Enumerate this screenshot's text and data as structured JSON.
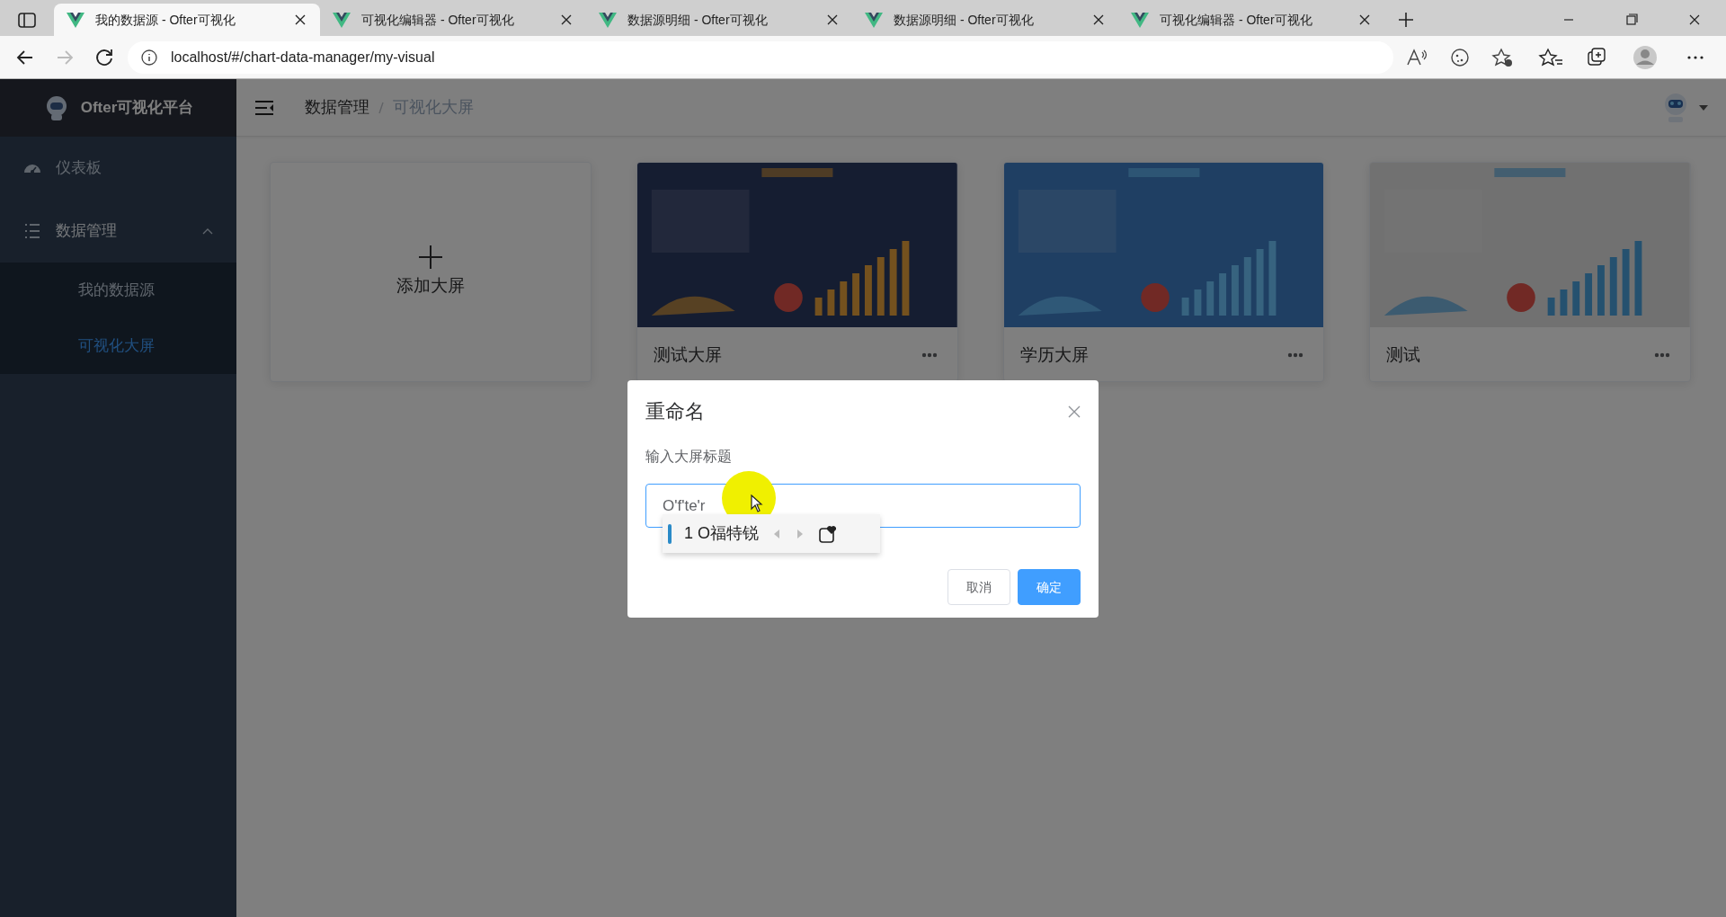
{
  "browser": {
    "tabs": [
      {
        "title": "我的数据源 - Ofter可视化",
        "selected": true
      },
      {
        "title": "可视化编辑器 - Ofter可视化",
        "selected": false
      },
      {
        "title": "数据源明细 - Ofter可视化",
        "selected": false
      },
      {
        "title": "数据源明细 - Ofter可视化",
        "selected": false
      },
      {
        "title": "可视化编辑器 - Ofter可视化",
        "selected": false
      }
    ],
    "address": "localhost/#/chart-data-manager/my-visual"
  },
  "app": {
    "brand": "Ofter可视化平台",
    "menu": [
      {
        "label": "仪表板",
        "kind": "gauge"
      },
      {
        "label": "数据管理",
        "kind": "list",
        "expanded": true,
        "children": [
          {
            "label": "我的数据源",
            "selected": false
          },
          {
            "label": "可视化大屏",
            "selected": true
          }
        ]
      }
    ],
    "breadcrumb": [
      "数据管理",
      "可视化大屏"
    ],
    "add_card": {
      "label": "添加大屏"
    },
    "screens": [
      {
        "title": "测试大屏",
        "kind": "picture"
      },
      {
        "title": "学历大屏",
        "kind": "picture"
      },
      {
        "title": "测试",
        "kind": "picture"
      }
    ]
  },
  "dialog": {
    "title": "重命名",
    "label": "输入大屏标题",
    "value": "O'f'te'r",
    "ime_candidate": "1 O福特锐",
    "buttons": [
      {
        "label": "取消",
        "kind": "default"
      },
      {
        "label": "确定",
        "kind": "primary"
      }
    ]
  }
}
